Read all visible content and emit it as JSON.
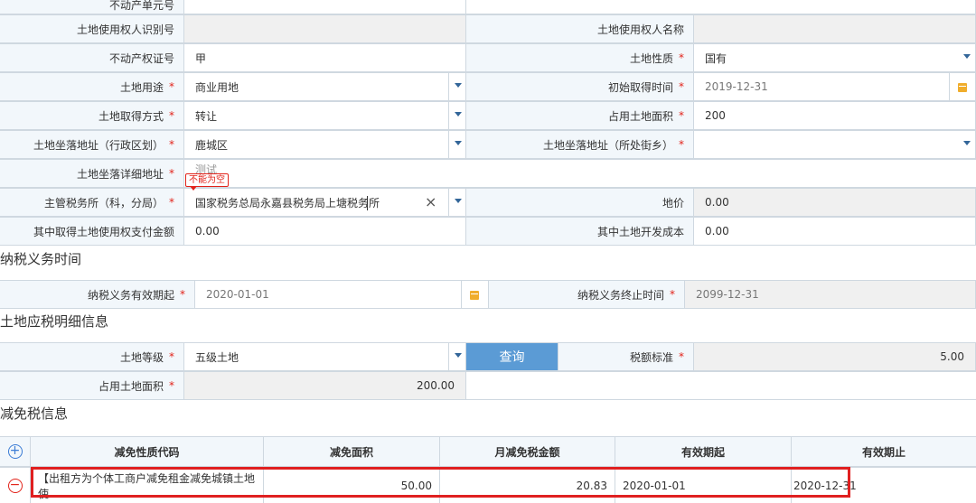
{
  "land_info": {
    "unit_no_label": "不动产单元号",
    "user_id_label": "土地使用权人识别号",
    "user_name_label": "土地使用权人名称",
    "cert_label": "不动产权证号",
    "cert_value": "甲",
    "nature_label": "土地性质",
    "nature_value": "国有",
    "usage_label": "土地用途",
    "usage_value": "商业用地",
    "first_time_label": "初始取得时间",
    "first_time_value": "2019-12-31",
    "method_label": "土地取得方式",
    "method_value": "转让",
    "area_label": "占用土地面积",
    "area_value": "200",
    "district_label": "土地坐落地址（行政区划）",
    "district_value": "鹿城区",
    "street_label": "土地坐落地址（所处街乡）",
    "street_value": "",
    "detail_label": "土地坐落详细地址",
    "detail_value": "测试",
    "error_tip": "不能为空",
    "tax_office_label": "主管税务所（科，分局）",
    "tax_office_value": "国家税务总局永嘉县税务局上塘税务所",
    "land_price_label": "地价",
    "land_price_value": "0.00",
    "pay_amount_label": "其中取得土地使用权支付金额",
    "pay_amount_value": "0.00",
    "dev_cost_label": "其中土地开发成本",
    "dev_cost_value": "0.00",
    "required_mark": "*"
  },
  "tax_period": {
    "section_title": "纳税义务时间",
    "start_label": "纳税义务有效期起",
    "start_value": "2020-01-01",
    "end_label": "纳税义务终止时间",
    "end_value": "2099-12-31"
  },
  "tax_detail": {
    "section_title": "土地应税明细信息",
    "grade_label": "土地等级",
    "grade_value": "五级土地",
    "query_button": "查询",
    "standard_label": "税额标准",
    "standard_value": "5.00",
    "area_label": "占用土地面积",
    "area_value": "200.00"
  },
  "exemption": {
    "section_title": "减免税信息",
    "headers": [
      "减免性质代码",
      "减免面积",
      "月减免税金额",
      "有效期起",
      "有效期止"
    ],
    "row": {
      "code": "【出租方为个体工商户减免租金减免城镇土地使...",
      "area": "50.00",
      "monthly": "20.83",
      "start": "2020-01-01",
      "end": "2020-12-31"
    }
  },
  "colors": {
    "label_bg": "#f2f7fb",
    "border": "#cfd8e0",
    "required": "#e2231a",
    "button": "#5b9bd5",
    "highlight": "#e02020"
  }
}
